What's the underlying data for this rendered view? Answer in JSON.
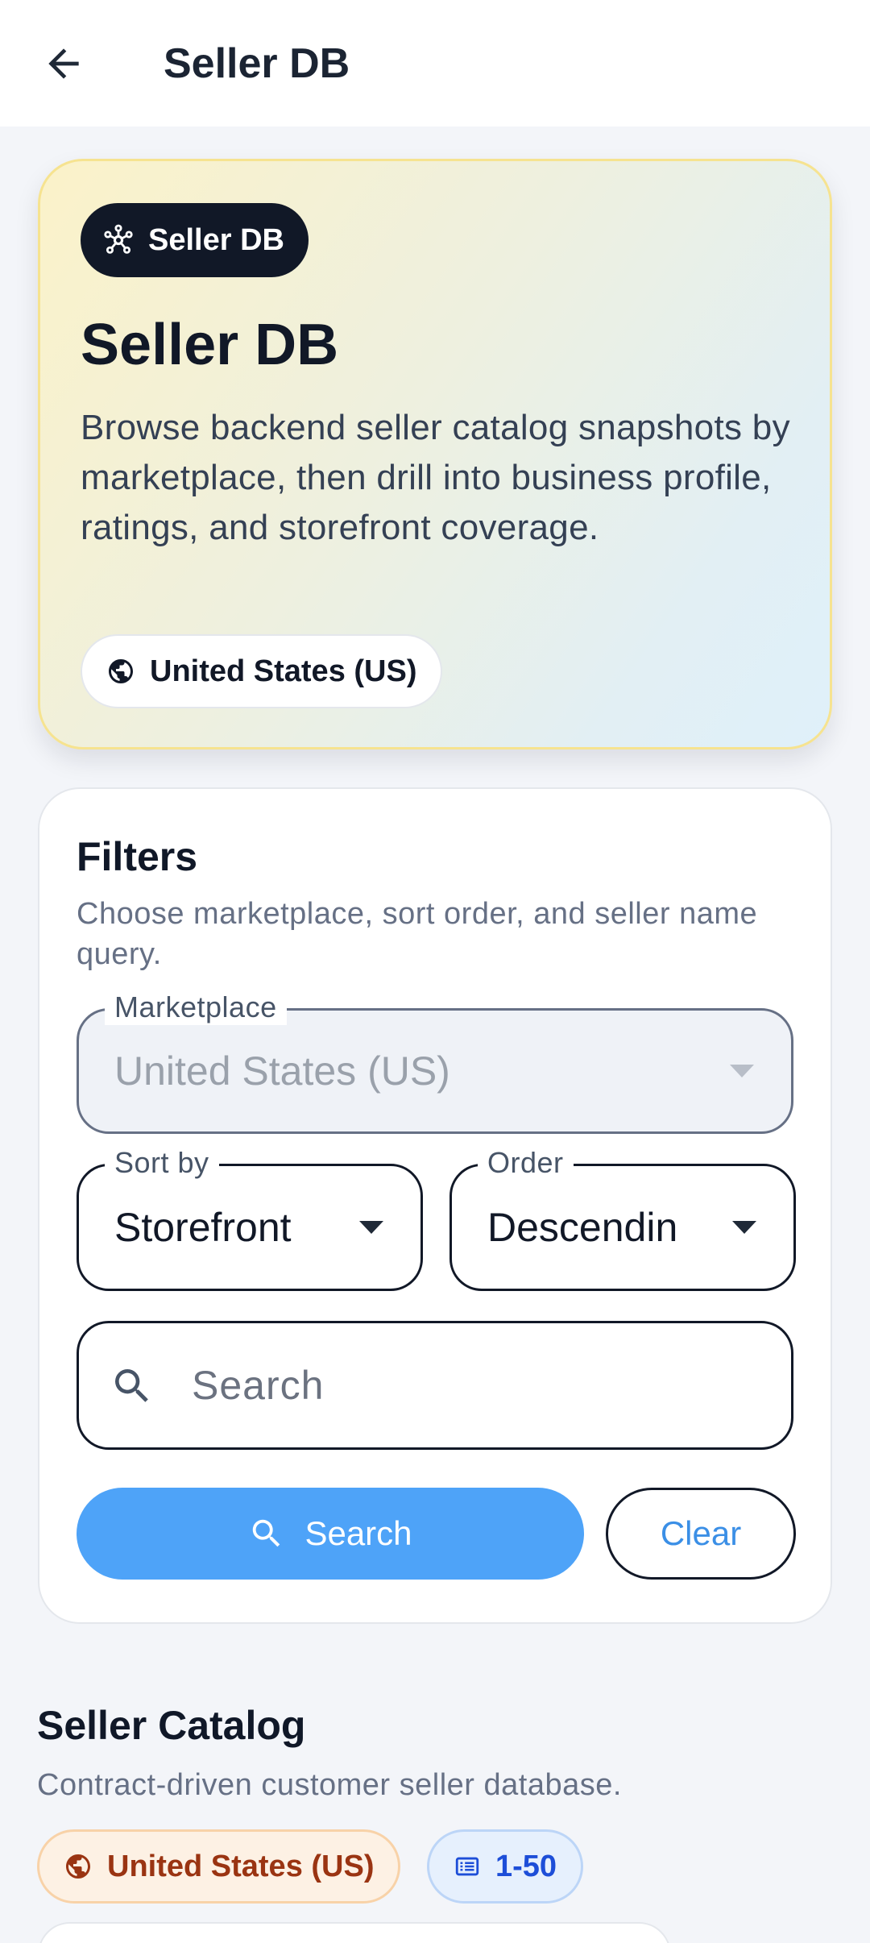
{
  "appbar": {
    "title": "Seller DB"
  },
  "hero": {
    "chip_label": "Seller DB",
    "title": "Seller DB",
    "description": "Browse backend seller catalog snapshots by marketplace, then drill into business profile, ratings, and storefront coverage.",
    "marketplace_pill": "United States (US)"
  },
  "filters": {
    "title": "Filters",
    "subtitle": "Choose marketplace, sort order, and seller name query.",
    "marketplace": {
      "label": "Marketplace",
      "value": "United States (US)"
    },
    "sort_by": {
      "label": "Sort by",
      "value": "Storefront"
    },
    "order": {
      "label": "Order",
      "value": "Descendin"
    },
    "search": {
      "placeholder": "Search"
    },
    "search_button": "Search",
    "clear_button": "Clear"
  },
  "catalog": {
    "title": "Seller Catalog",
    "subtitle": "Contract-driven customer seller database.",
    "marketplace_badge": "United States (US)",
    "range_badge": "1-50"
  },
  "icons": {
    "back": "arrow-left-icon",
    "hub": "hub-network-icon",
    "globe": "globe-icon",
    "search": "search-icon",
    "list": "list-icon",
    "caret": "caret-down-icon"
  },
  "colors": {
    "primary": "#4ea3f8",
    "dark": "#111827",
    "hero_border": "#f6e390",
    "marketplace_badge_text": "#9a3412",
    "range_badge_text": "#1d4ed8"
  }
}
